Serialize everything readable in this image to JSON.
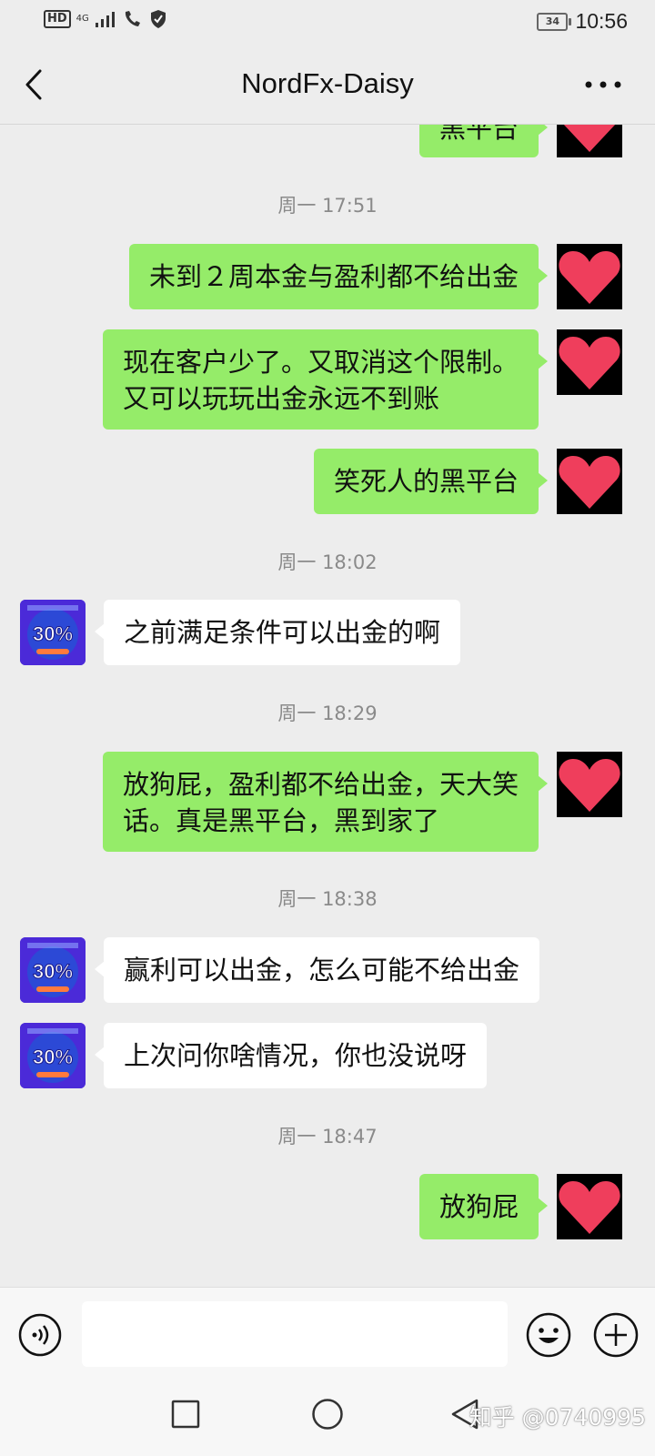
{
  "status_bar": {
    "hd_label": "HD",
    "network": "4G",
    "battery": "34",
    "time": "10:56"
  },
  "header": {
    "title": "NordFx-Daisy",
    "back_icon": "chevron-left-icon",
    "more_icon": "more-dots-icon"
  },
  "avatars": {
    "bot_badge": "30%"
  },
  "messages": [
    {
      "type": "sent",
      "text": "黑平台"
    },
    {
      "type": "time",
      "text": "周一 17:51"
    },
    {
      "type": "sent",
      "text": "未到２周本金与盈利都不给出金"
    },
    {
      "type": "sent",
      "lines": [
        "现在客户少了。又取消这个限制。",
        "又可以玩玩出金永远不到账"
      ]
    },
    {
      "type": "sent",
      "text": "笑死人的黑平台"
    },
    {
      "type": "time",
      "text": "周一 18:02"
    },
    {
      "type": "received",
      "text": "之前满足条件可以出金的啊"
    },
    {
      "type": "time",
      "text": "周一 18:29"
    },
    {
      "type": "sent",
      "lines": [
        "放狗屁，盈利都不给出金，天大笑",
        "话。真是黑平台，黑到家了"
      ]
    },
    {
      "type": "time",
      "text": "周一 18:38"
    },
    {
      "type": "received",
      "text": "赢利可以出金，怎么可能不给出金"
    },
    {
      "type": "received",
      "text": "上次问你啥情况，你也没说呀"
    },
    {
      "type": "time",
      "text": "周一 18:47"
    },
    {
      "type": "sent",
      "text": "放狗屁"
    }
  ],
  "input_bar": {
    "message_value": "",
    "voice_icon": "voice-icon",
    "emoji_icon": "emoji-icon",
    "plus_icon": "plus-icon"
  },
  "system_nav": {
    "watermark": "知乎 @0740995"
  },
  "colors": {
    "sent_bubble": "#95ec69",
    "received_bubble": "#ffffff",
    "background": "#ededed",
    "heart": "#ef3e5c"
  }
}
